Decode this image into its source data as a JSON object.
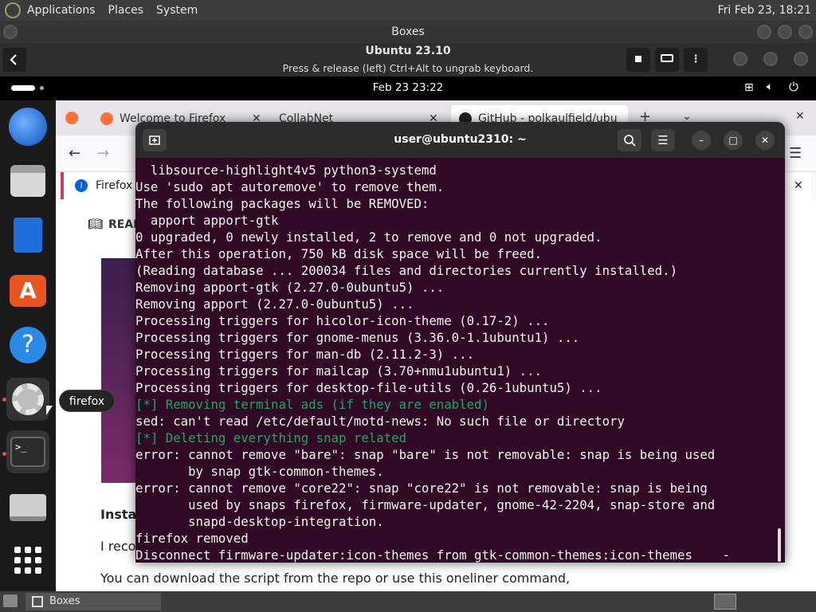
{
  "host_panel": {
    "menus": [
      "Applications",
      "Places",
      "System"
    ],
    "clock": "Fri Feb 23, 18:21"
  },
  "boxes": {
    "window_title": "Boxes",
    "vm_title": "Ubuntu 23.10",
    "vm_hint": "Press & release (left) Ctrl+Alt to ungrab keyboard."
  },
  "guest_topbar": {
    "clock": "Feb 23  23:22"
  },
  "dock": {
    "tooltip": "firefox",
    "items": [
      "thunderbird-icon",
      "files-icon",
      "writer-icon",
      "app-center-icon",
      "help-icon",
      "settings-icon",
      "terminal-icon",
      "disk-icon",
      "app-grid-icon"
    ]
  },
  "firefox": {
    "tabs": [
      "Welcome to Firefox",
      "CollabNet",
      "GitHub - polkaulfield/ubu"
    ],
    "notice_text": "Firefox a",
    "reader_label": "READ",
    "heading": "Insta",
    "para1": "I reco",
    "para2": "You can download the script from the repo or use this oneliner command,"
  },
  "terminal": {
    "title": "user@ubuntu2310: ~",
    "lines": [
      {
        "text": "  libsource-highlight4v5 python3-systemd",
        "green": false
      },
      {
        "text": "Use 'sudo apt autoremove' to remove them.",
        "green": false
      },
      {
        "text": "The following packages will be REMOVED:",
        "green": false
      },
      {
        "text": "  apport apport-gtk",
        "green": false
      },
      {
        "text": "0 upgraded, 0 newly installed, 2 to remove and 0 not upgraded.",
        "green": false
      },
      {
        "text": "After this operation, 750 kB disk space will be freed.",
        "green": false
      },
      {
        "text": "(Reading database ... 200034 files and directories currently installed.)",
        "green": false
      },
      {
        "text": "Removing apport-gtk (2.27.0-0ubuntu5) ...",
        "green": false
      },
      {
        "text": "Removing apport (2.27.0-0ubuntu5) ...",
        "green": false
      },
      {
        "text": "Processing triggers for hicolor-icon-theme (0.17-2) ...",
        "green": false
      },
      {
        "text": "Processing triggers for gnome-menus (3.36.0-1.1ubuntu1) ...",
        "green": false
      },
      {
        "text": "Processing triggers for man-db (2.11.2-3) ...",
        "green": false
      },
      {
        "text": "Processing triggers for mailcap (3.70+nmu1ubuntu1) ...",
        "green": false
      },
      {
        "text": "Processing triggers for desktop-file-utils (0.26-1ubuntu5) ...",
        "green": false
      },
      {
        "text": "[*] Removing terminal ads (if they are enabled)",
        "green": true
      },
      {
        "text": "sed: can't read /etc/default/motd-news: No such file or directory",
        "green": false
      },
      {
        "text": "[*] Deleting everything snap related",
        "green": true
      },
      {
        "text": "error: cannot remove \"bare\": snap \"bare\" is not removable: snap is being used",
        "green": false
      },
      {
        "text": "       by snap gtk-common-themes.",
        "green": false
      },
      {
        "text": "error: cannot remove \"core22\": snap \"core22\" is not removable: snap is being",
        "green": false
      },
      {
        "text": "       used by snaps firefox, firmware-updater, gnome-42-2204, snap-store and",
        "green": false
      },
      {
        "text": "       snapd-desktop-integration.",
        "green": false
      },
      {
        "text": "firefox removed",
        "green": false
      },
      {
        "text": "Disconnect firmware-updater:icon-themes from gtk-common-themes:icon-themes    -",
        "green": false
      }
    ]
  },
  "host_bottom": {
    "task_label": "Boxes"
  },
  "colors": {
    "terminal_bg": "#300a24",
    "accent": "#e95420",
    "green": "#26a269"
  }
}
